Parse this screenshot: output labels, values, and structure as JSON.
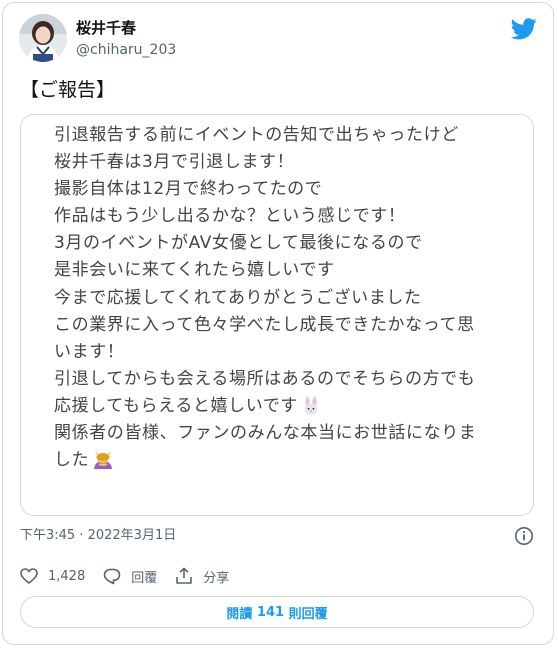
{
  "author": {
    "display_name": "桜井千春",
    "handle": "@chiharu_203"
  },
  "tweet": {
    "headline": "【ご報告】",
    "message_lines": [
      "引退報告する前にイベントの告知で出ちゃったけど",
      "桜井千春は3月で引退します！",
      "撮影自体は12月で終わってたので",
      "作品はもう少し出るかな？という感じです！",
      "3月のイベントがAV女優として最後になるので",
      "是非会いに来てくれたら嬉しいです",
      "今まで応援してくれてありがとうございました",
      "この業界に入って色々学べたし成長できたかなって思",
      "います！",
      "引退してからも会える場所はあるのでそちらの方でも",
      "応援してもらえると嬉しいです",
      "関係者の皆様、ファンのみんな本当にお世話になりま",
      "した"
    ],
    "timestamp": "下午3:45 · 2022年3月1日"
  },
  "actions": {
    "likes": "1,428",
    "reply_label": "回覆",
    "share_label": "分享"
  },
  "read_replies": {
    "prefix": "閱讀 ",
    "count": "141",
    "suffix": " 則回覆"
  },
  "icons": {
    "logo": "twitter-bird-icon",
    "line11_emoji": "rabbit-face-emoji",
    "line13_emoji": "person-bowing-emoji"
  },
  "colors": {
    "brand": "#1d9bf0",
    "text": "#0f1419",
    "muted": "#536471",
    "border": "#cfd9de",
    "message_text": "#444444"
  }
}
